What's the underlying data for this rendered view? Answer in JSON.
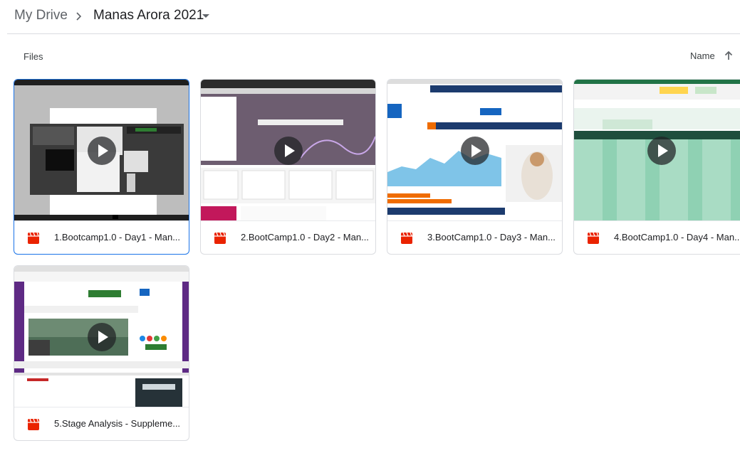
{
  "breadcrumb": {
    "root": "My Drive",
    "current": "Manas Arora 2021"
  },
  "section": {
    "label": "Files",
    "sort_label": "Name"
  },
  "icons": {
    "separator": "chevron-right-icon",
    "caret": "arrow-drop-down-icon",
    "sort": "arrow-up-icon",
    "file_type": "video-file-icon",
    "thumbnail_overlay": "play-icon"
  },
  "colors": {
    "selection": "#1a73e8",
    "video_icon": "#ea2300"
  },
  "files": [
    {
      "name": "1.Bootcamp1.0 - Day1 - Man...",
      "selected": true
    },
    {
      "name": "2.BootCamp1.0 - Day2 - Man...",
      "selected": false
    },
    {
      "name": "3.BootCamp1.0 - Day3 - Man...",
      "selected": false
    },
    {
      "name": "4.BootCamp1.0 - Day4 - Man...",
      "selected": false
    },
    {
      "name": "5.Stage Analysis - Suppleme...",
      "selected": false
    }
  ]
}
